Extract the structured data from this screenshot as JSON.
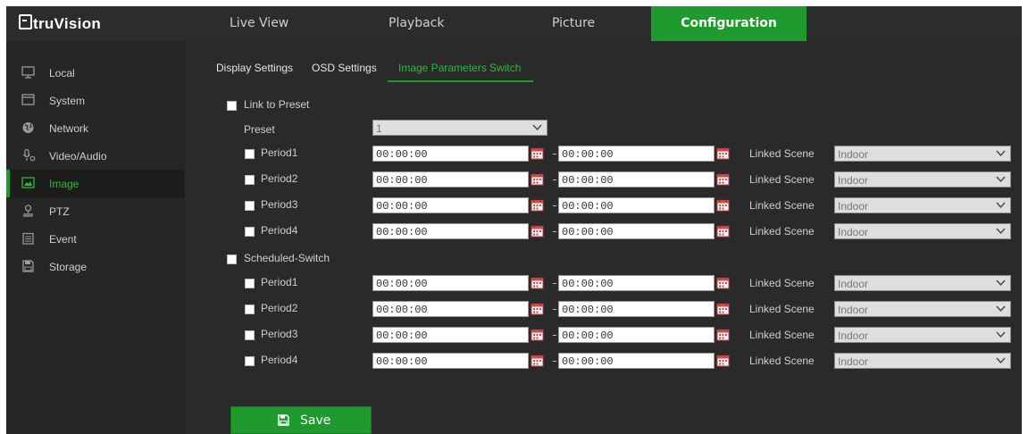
{
  "brand": {
    "name": "truVision"
  },
  "nav": {
    "tabs": [
      {
        "label": "Live View"
      },
      {
        "label": "Playback"
      },
      {
        "label": "Picture"
      },
      {
        "label": "Configuration"
      }
    ],
    "active_tab": "Configuration"
  },
  "sidebar": {
    "items": [
      {
        "label": "Local",
        "icon": "monitor-icon"
      },
      {
        "label": "System",
        "icon": "window-icon"
      },
      {
        "label": "Network",
        "icon": "globe-icon"
      },
      {
        "label": "Video/Audio",
        "icon": "microphone-icon"
      },
      {
        "label": "Image",
        "icon": "image-icon"
      },
      {
        "label": "PTZ",
        "icon": "ptz-camera-icon"
      },
      {
        "label": "Event",
        "icon": "calendar-icon"
      },
      {
        "label": "Storage",
        "icon": "floppy-disk-icon"
      }
    ],
    "active": "Image"
  },
  "subtabs": [
    {
      "label": "Display Settings"
    },
    {
      "label": "OSD Settings"
    },
    {
      "label": "Image Parameters Switch"
    }
  ],
  "active_subtab": "Image Parameters Switch",
  "form": {
    "link_to_preset": {
      "label": "Link to Preset",
      "checked": false
    },
    "preset": {
      "label": "Preset",
      "value": "1"
    },
    "linked_scene_label": "Linked Scene",
    "preset_periods": [
      {
        "label": "Period1",
        "start": "00:00:00",
        "end": "00:00:00",
        "scene": "Indoor"
      },
      {
        "label": "Period2",
        "start": "00:00:00",
        "end": "00:00:00",
        "scene": "Indoor"
      },
      {
        "label": "Period3",
        "start": "00:00:00",
        "end": "00:00:00",
        "scene": "Indoor"
      },
      {
        "label": "Period4",
        "start": "00:00:00",
        "end": "00:00:00",
        "scene": "Indoor"
      }
    ],
    "scheduled_switch": {
      "label": "Scheduled-Switch",
      "checked": false
    },
    "scheduled_periods": [
      {
        "label": "Period1",
        "start": "00:00:00",
        "end": "00:00:00",
        "scene": "Indoor"
      },
      {
        "label": "Period2",
        "start": "00:00:00",
        "end": "00:00:00",
        "scene": "Indoor"
      },
      {
        "label": "Period3",
        "start": "00:00:00",
        "end": "00:00:00",
        "scene": "Indoor"
      },
      {
        "label": "Period4",
        "start": "00:00:00",
        "end": "00:00:00",
        "scene": "Indoor"
      }
    ]
  },
  "save_button": {
    "label": "Save",
    "icon": "floppy-disk-icon"
  },
  "colors": {
    "accent": "#1f9a2c",
    "accent_text": "#2fb83c",
    "background": "#262626",
    "panel": "#2a2a2a"
  }
}
